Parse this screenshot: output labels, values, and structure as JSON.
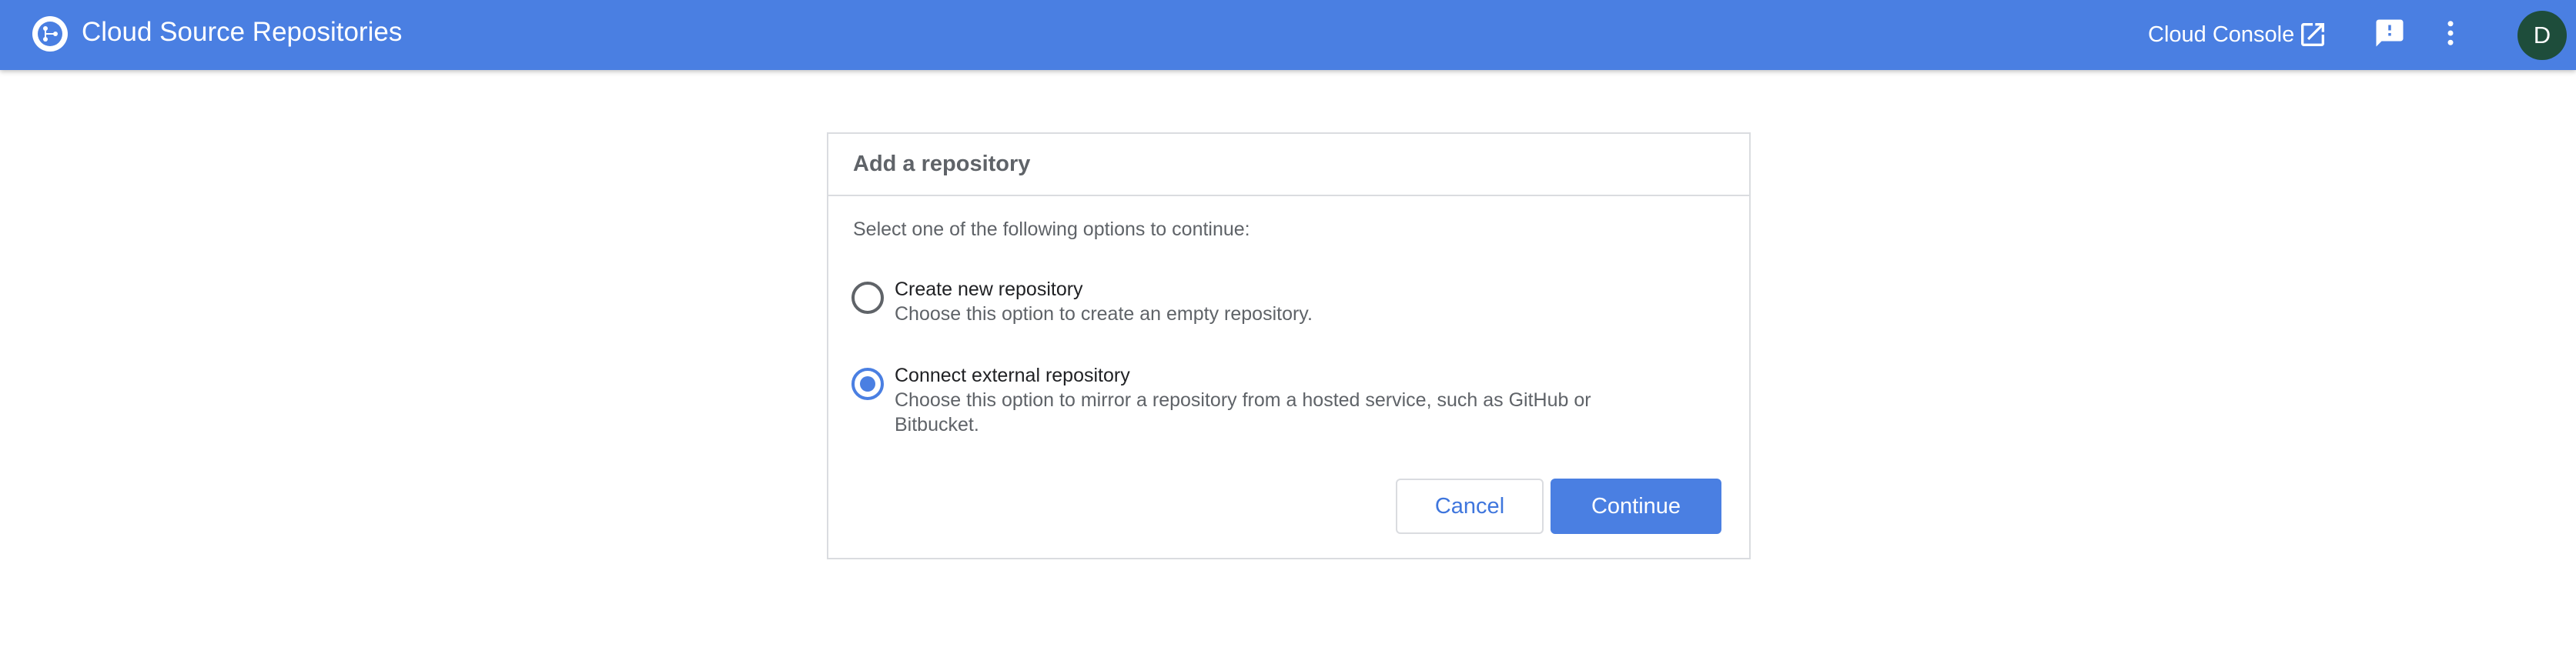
{
  "app": {
    "title": "Cloud Source Repositories",
    "logo_icon": "source-repositories-logo",
    "accent_color": "#4a7fe2"
  },
  "header": {
    "console_link_label": "Cloud Console",
    "console_link_icon": "open-in-new-icon",
    "feedback_icon": "feedback-icon",
    "more_icon": "more-vert-icon",
    "avatar_initial": "D"
  },
  "dialog": {
    "title": "Add a repository",
    "instruction": "Select one of the following options to continue:",
    "options": [
      {
        "label": "Create new repository",
        "description": "Choose this option to create an empty repository.",
        "selected": false
      },
      {
        "label": "Connect external repository",
        "description": "Choose this option to mirror a repository from a hosted service, such as GitHub or Bitbucket.",
        "selected": true
      }
    ],
    "cancel_label": "Cancel",
    "continue_label": "Continue"
  }
}
